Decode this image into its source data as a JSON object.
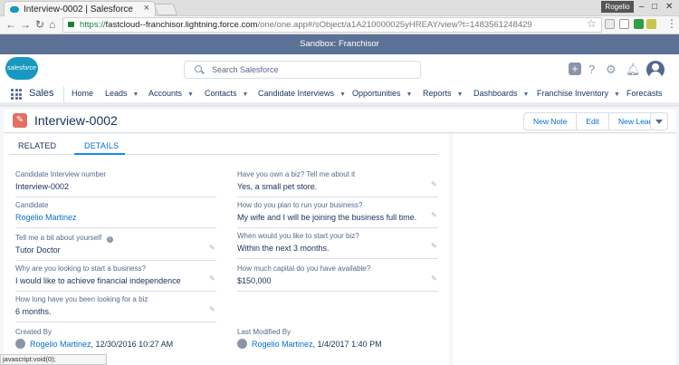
{
  "browser": {
    "tab_title": "Interview-0002 | Salesforce",
    "tab_close": "×",
    "profile": "Rogelio",
    "url_scheme": "https://",
    "url_host": "fastcloud--franchisor.lightning.force.com",
    "url_path": "/one/one.app#/sObject/a1A210000025yHREAY/view?t=1483561248429",
    "status": "javascript:void(0);"
  },
  "sandbox_banner": "Sandbox: Franchisor",
  "header": {
    "logo_text": "salesforce",
    "search_placeholder": "Search Salesforce"
  },
  "nav": {
    "app_name": "Sales",
    "items": [
      {
        "label": "Home",
        "dropdown": false
      },
      {
        "label": "Leads",
        "dropdown": true
      },
      {
        "label": "Accounts",
        "dropdown": true
      },
      {
        "label": "Contacts",
        "dropdown": true
      },
      {
        "label": "Candidate Interviews",
        "dropdown": true
      },
      {
        "label": "Opportunities",
        "dropdown": true
      },
      {
        "label": "Reports",
        "dropdown": true
      },
      {
        "label": "Dashboards",
        "dropdown": true
      },
      {
        "label": "Franchise Inventory",
        "dropdown": true
      },
      {
        "label": "Forecasts",
        "dropdown": false
      }
    ]
  },
  "record": {
    "title": "Interview-0002",
    "buttons": [
      "New Note",
      "Edit",
      "New Lead"
    ]
  },
  "tabs": {
    "related": "RELATED",
    "details": "DETAILS"
  },
  "fields_left": [
    {
      "label": "Candidate Interview number",
      "value": "Interview-0002"
    },
    {
      "label": "Candidate",
      "value": "Rogelio Martinez"
    },
    {
      "label": "Tell me a bit about yourself",
      "value": "Tutor Doctor"
    },
    {
      "label": "Why are you looking to start a business?",
      "value": "I would like to achieve financial independence"
    },
    {
      "label": "How long have you been looking for a biz",
      "value": "6 months."
    },
    {
      "label": "Created By",
      "user": "Rogelio Martinez",
      "date": ", 12/30/2016 10:27 AM"
    }
  ],
  "fields_right": [
    {
      "label": "Have you own a biz? Tell me about it",
      "value": "Yes, a small pet store."
    },
    {
      "label": "How do you plan to run your business?",
      "value": "My wife and I will be joining the business full time."
    },
    {
      "label": "When would you like to start your biz?",
      "value": "Within the next 3 months."
    },
    {
      "label": "How much capital do you have available?",
      "value": "$150,000"
    },
    {
      "label": "Last Modified By",
      "user": "Rogelio Martinez",
      "date": ", 1/4/2017 1:40 PM"
    }
  ],
  "colors": {
    "brand": "#1798c1",
    "sandbox": "#5b7196",
    "link": "#0070d2",
    "record_icon": "#e46e63"
  }
}
